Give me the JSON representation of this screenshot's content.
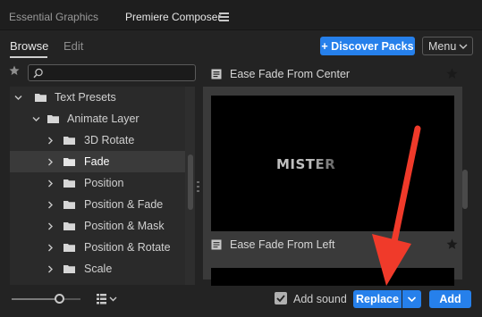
{
  "tabs": [
    {
      "label": "Essential Graphics",
      "active": false
    },
    {
      "label": "Premiere Composer",
      "active": true
    }
  ],
  "subtabs": {
    "browse": "Browse",
    "edit": "Edit"
  },
  "toolbar": {
    "discover_label": "+ Discover Packs",
    "menu_label": "Menu"
  },
  "search": {
    "value": "",
    "placeholder": ""
  },
  "tree": [
    {
      "label": "Text Presets",
      "level": 0,
      "expanded": true,
      "selected": false
    },
    {
      "label": "Animate Layer",
      "level": 1,
      "expanded": true,
      "selected": false
    },
    {
      "label": "3D Rotate",
      "level": 2,
      "expanded": false,
      "selected": false
    },
    {
      "label": "Fade",
      "level": 2,
      "expanded": false,
      "selected": true
    },
    {
      "label": "Position",
      "level": 2,
      "expanded": false,
      "selected": false
    },
    {
      "label": "Position & Fade",
      "level": 2,
      "expanded": false,
      "selected": false
    },
    {
      "label": "Position & Mask",
      "level": 2,
      "expanded": false,
      "selected": false
    },
    {
      "label": "Position & Rotate",
      "level": 2,
      "expanded": false,
      "selected": false
    },
    {
      "label": "Scale",
      "level": 2,
      "expanded": false,
      "selected": false
    }
  ],
  "presets": [
    {
      "title": "Ease Fade From Center",
      "selected": false
    },
    {
      "title": "Ease Fade From Left",
      "selected": true,
      "preview_text": "MISTER"
    }
  ],
  "bottom": {
    "add_sound_label": "Add sound",
    "add_sound_checked": true,
    "replace_label": "Replace",
    "add_label": "Add"
  },
  "colors": {
    "accent": "#2680eb",
    "annotation": "#f03a2a"
  }
}
